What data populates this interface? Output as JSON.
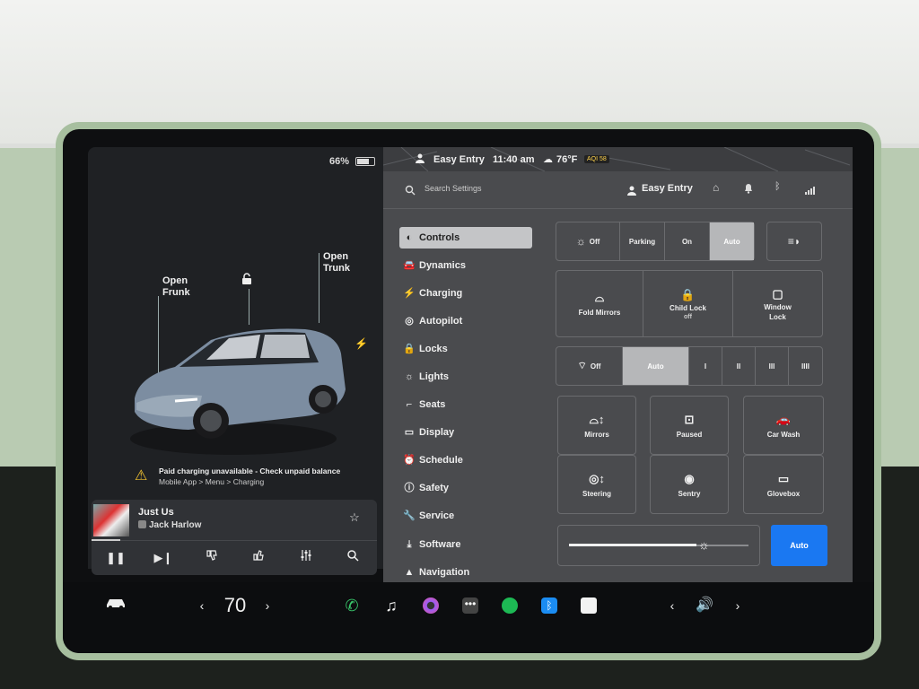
{
  "status": {
    "battery": "66%"
  },
  "car_view": {
    "frunk_line1": "Open",
    "frunk_line2": "Frunk",
    "trunk_line1": "Open",
    "trunk_line2": "Trunk",
    "alert_title": "Paid charging unavailable - Check unpaid balance",
    "alert_path": "Mobile App > Menu > Charging"
  },
  "media": {
    "track": "Just Us",
    "artist": "Jack Harlow"
  },
  "topbar": {
    "profile": "Easy Entry",
    "time": "11:40 am",
    "temp": "76°F",
    "aqi": "AQI 58"
  },
  "settings_header": {
    "search_placeholder": "Search Settings",
    "profile": "Easy Entry"
  },
  "menu": [
    {
      "label": "Controls",
      "icon": "toggle-icon"
    },
    {
      "label": "Dynamics",
      "icon": "car-icon"
    },
    {
      "label": "Charging",
      "icon": "bolt-icon"
    },
    {
      "label": "Autopilot",
      "icon": "steering-wheel-icon"
    },
    {
      "label": "Locks",
      "icon": "lock-icon"
    },
    {
      "label": "Lights",
      "icon": "sun-icon"
    },
    {
      "label": "Seats",
      "icon": "seat-icon"
    },
    {
      "label": "Display",
      "icon": "display-icon"
    },
    {
      "label": "Schedule",
      "icon": "clock-icon"
    },
    {
      "label": "Safety",
      "icon": "info-icon"
    },
    {
      "label": "Service",
      "icon": "wrench-icon"
    },
    {
      "label": "Software",
      "icon": "download-icon"
    },
    {
      "label": "Navigation",
      "icon": "navigation-icon"
    }
  ],
  "lights": {
    "off": "Off",
    "parking": "Parking",
    "on": "On",
    "auto": "Auto",
    "selected": "Auto"
  },
  "row2": {
    "fold_mirrors": "Fold Mirrors",
    "child_lock": "Child Lock",
    "child_lock_state": "off",
    "window_lock_1": "Window",
    "window_lock_2": "Lock"
  },
  "wipers": {
    "off": "Off",
    "auto": "Auto",
    "s1": "I",
    "s2": "II",
    "s3": "III",
    "s4": "IIII",
    "selected": "Auto"
  },
  "tiles": {
    "mirrors": "Mirrors",
    "paused": "Paused",
    "car_wash": "Car Wash",
    "steering": "Steering",
    "sentry": "Sentry",
    "glovebox": "Glovebox"
  },
  "brightness": {
    "auto_label": "Auto",
    "level": 0.75
  },
  "taskbar": {
    "temperature": "70",
    "left_arrow": "‹",
    "right_arrow": "›"
  },
  "colors": {
    "accent": "#1a78f2",
    "phone": "#39c46a",
    "spotify": "#1db954",
    "bluetooth": "#1b8cf2"
  }
}
